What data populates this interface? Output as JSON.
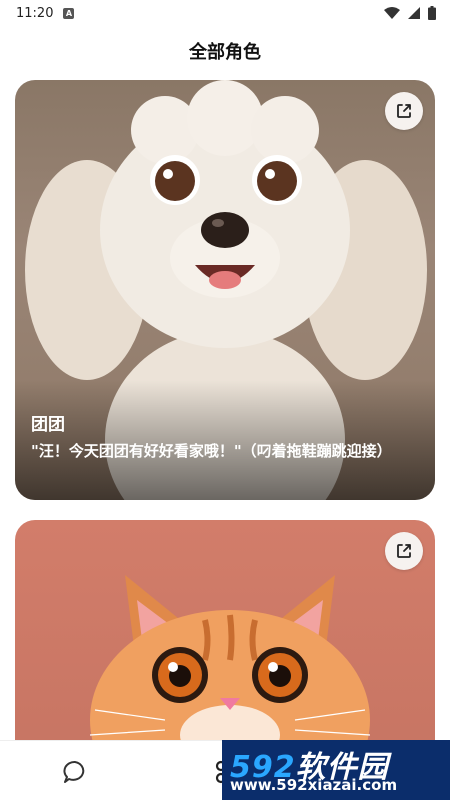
{
  "status_bar": {
    "time": "11:20",
    "app_badge": "A"
  },
  "header": {
    "title": "全部角色"
  },
  "cards": [
    {
      "name": "团团",
      "description": "\"汪！今天团团有好好看家哦！\"（叼着拖鞋蹦跳迎接）",
      "share_icon": "share-icon",
      "image": "white-poodle-puppy-illustration"
    },
    {
      "name": "",
      "description": "",
      "share_icon": "share-icon",
      "image": "orange-tabby-cat-illustration"
    }
  ],
  "bottom_nav": {
    "items": [
      {
        "icon": "chat-bubble-icon"
      },
      {
        "icon": "roles-icon"
      }
    ]
  },
  "watermark": {
    "brand_num": "592",
    "brand_text": "软件园",
    "url": "www.592xiazai.com"
  }
}
